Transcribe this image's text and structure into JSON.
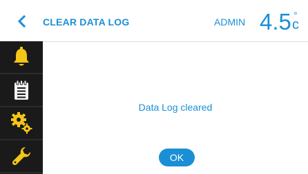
{
  "header": {
    "title": "CLEAR DATA LOG",
    "user": "ADMIN",
    "temperature": {
      "value": "4.5",
      "degree_symbol": "°",
      "unit": "c"
    },
    "back_icon": "chevron-left-icon"
  },
  "sidebar": {
    "items": [
      {
        "icon": "bell-icon"
      },
      {
        "icon": "clipboard-icon"
      },
      {
        "icon": "gears-icon"
      },
      {
        "icon": "wrench-icon"
      }
    ]
  },
  "main": {
    "message": "Data Log cleared",
    "ok_label": "OK"
  },
  "colors": {
    "accent": "#1a8fd6",
    "sidebar_bg": "#1a1a1a",
    "icon_yellow": "#f5c518",
    "icon_light": "#f2f2f2"
  }
}
